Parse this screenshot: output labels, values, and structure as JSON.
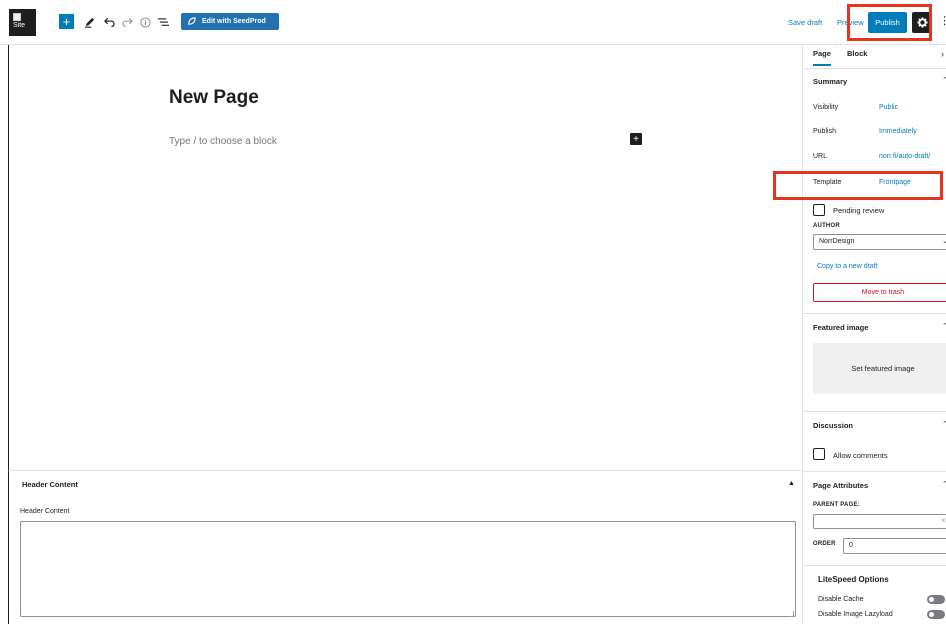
{
  "toolbar": {
    "site_label": "Site",
    "seedprod_label": "Edit with SeedProd",
    "save_draft": "Save draft",
    "preview": "Preview",
    "publish": "Publish"
  },
  "editor": {
    "title": "New Page",
    "placeholder": "Type / to choose a block"
  },
  "metabox": {
    "header": "Header Content",
    "field_label": "Header Content",
    "value": ""
  },
  "sidebar": {
    "tabs": [
      "Page",
      "Block"
    ],
    "summary": {
      "title": "Summary",
      "rows": [
        {
          "label": "Visibility",
          "value": "Public"
        },
        {
          "label": "Publish",
          "value": "Immediately"
        },
        {
          "label": "URL",
          "value": "norr.fi/auto-draft/"
        },
        {
          "label": "Template",
          "value": "Frontpage"
        }
      ],
      "pending_review": "Pending review",
      "author_label": "AUTHOR",
      "author_value": "NorrDesign",
      "copy_link": "Copy to a new draft",
      "trash_button": "Move to trash"
    },
    "featured": {
      "title": "Featured image",
      "button": "Set featured image"
    },
    "discussion": {
      "title": "Discussion",
      "allow_comments": "Allow comments"
    },
    "attributes": {
      "title": "Page Attributes",
      "parent_label": "PARENT PAGE:",
      "order_label": "ORDER",
      "order_value": "0"
    },
    "litespeed": {
      "title": "LiteSpeed Options",
      "options": [
        "Disable Cache",
        "Disable Image Lazyload"
      ]
    }
  }
}
